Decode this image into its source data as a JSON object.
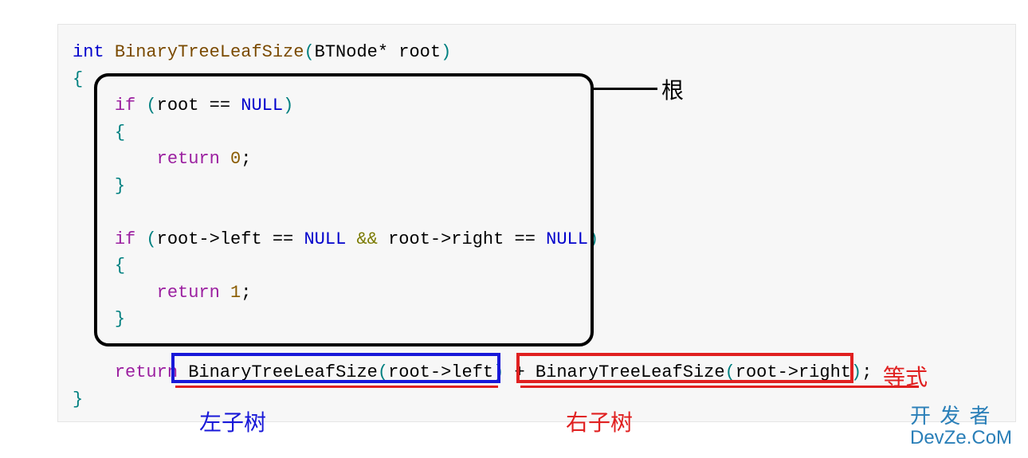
{
  "code": {
    "ret_type": "int",
    "func_name": "BinaryTreeLeafSize",
    "param_type": "BTNode*",
    "param_name": "root",
    "if1_cond_l": "root",
    "if1_eq": "==",
    "if1_null": "NULL",
    "ret0_kw": "return",
    "ret0_val": "0",
    "if2_l": "root->left",
    "if2_eq1": "==",
    "if2_null1": "NULL",
    "if2_and": "&&",
    "if2_r": "root->right",
    "if2_eq2": "==",
    "if2_null2": "NULL",
    "ret1_kw": "return",
    "ret1_val": "1",
    "ret2_kw": "return",
    "call_l_name": "BinaryTreeLeafSize",
    "call_l_arg": "root->left",
    "plus": "+",
    "call_r_name": "BinaryTreeLeafSize",
    "call_r_arg": "root->right",
    "kw_if": "if"
  },
  "labels": {
    "root": "根",
    "left": "左子树",
    "right": "右子树",
    "equation": "等式"
  },
  "watermark": {
    "line1": "开 发 者",
    "line2": "DevZe.CoM"
  },
  "colors": {
    "black": "#000000",
    "blue": "#1818d8",
    "red": "#e02020",
    "codebg": "#f7f7f7",
    "wm": "#2a7fb8"
  }
}
